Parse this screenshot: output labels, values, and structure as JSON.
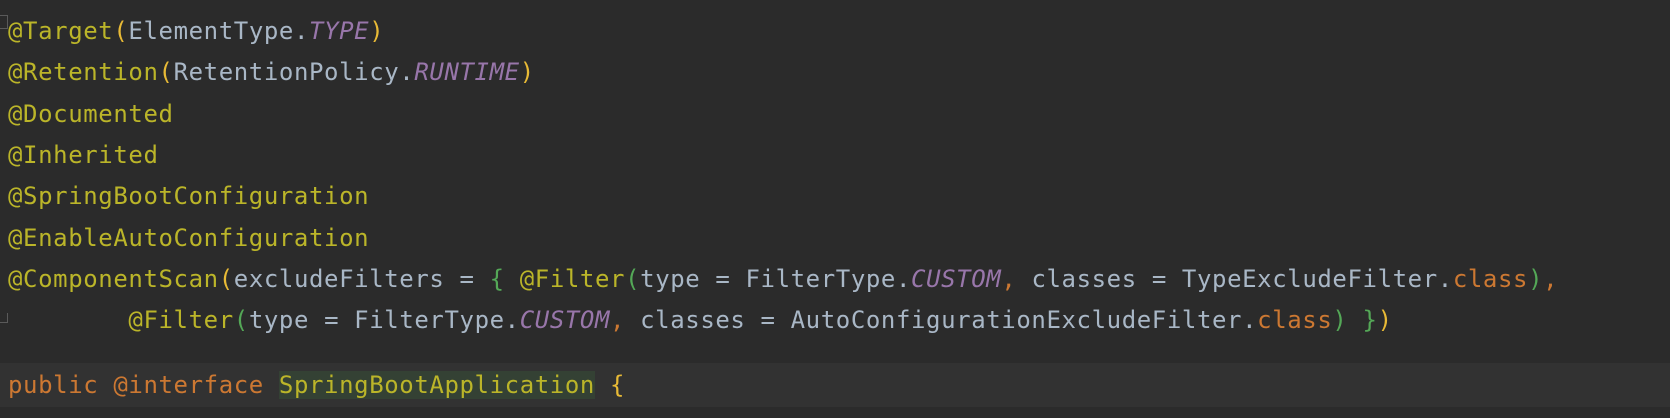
{
  "colors": {
    "background": "#2b2b2b",
    "current_line": "#323232",
    "annotation": "#bbb529",
    "plain": "#a9b7c6",
    "paren": "#e8ba36",
    "constant": "#9876aa",
    "keyword": "#cc7832",
    "brace": "#54a857",
    "declaration_highlight": "#344134"
  },
  "lines": [
    {
      "tokens": [
        "@Target",
        "(",
        "ElementType.",
        "TYPE",
        ")"
      ]
    },
    {
      "tokens": [
        "@Retention",
        "(",
        "RetentionPolicy.",
        "RUNTIME",
        ")"
      ]
    },
    {
      "tokens": [
        "@Documented"
      ]
    },
    {
      "tokens": [
        "@Inherited"
      ]
    },
    {
      "tokens": [
        "@SpringBootConfiguration"
      ]
    },
    {
      "tokens": [
        "@EnableAutoConfiguration"
      ]
    },
    {
      "tokens": [
        "@ComponentScan",
        "(",
        "excludeFilters = ",
        "{ ",
        "@Filter",
        "(",
        "type = FilterType.",
        "CUSTOM",
        ", ",
        "classes = TypeExcludeFilter.",
        "class",
        ")",
        ","
      ]
    },
    {
      "tokens": [
        "        ",
        "@Filter",
        "(",
        "type = FilterType.",
        "CUSTOM",
        ", ",
        "classes = AutoConfigurationExcludeFilter.",
        "class",
        ") ",
        "}",
        ")"
      ]
    },
    {
      "tokens": [
        "public ",
        "@interface ",
        "SpringBootApplication",
        " ",
        "{"
      ]
    }
  ]
}
